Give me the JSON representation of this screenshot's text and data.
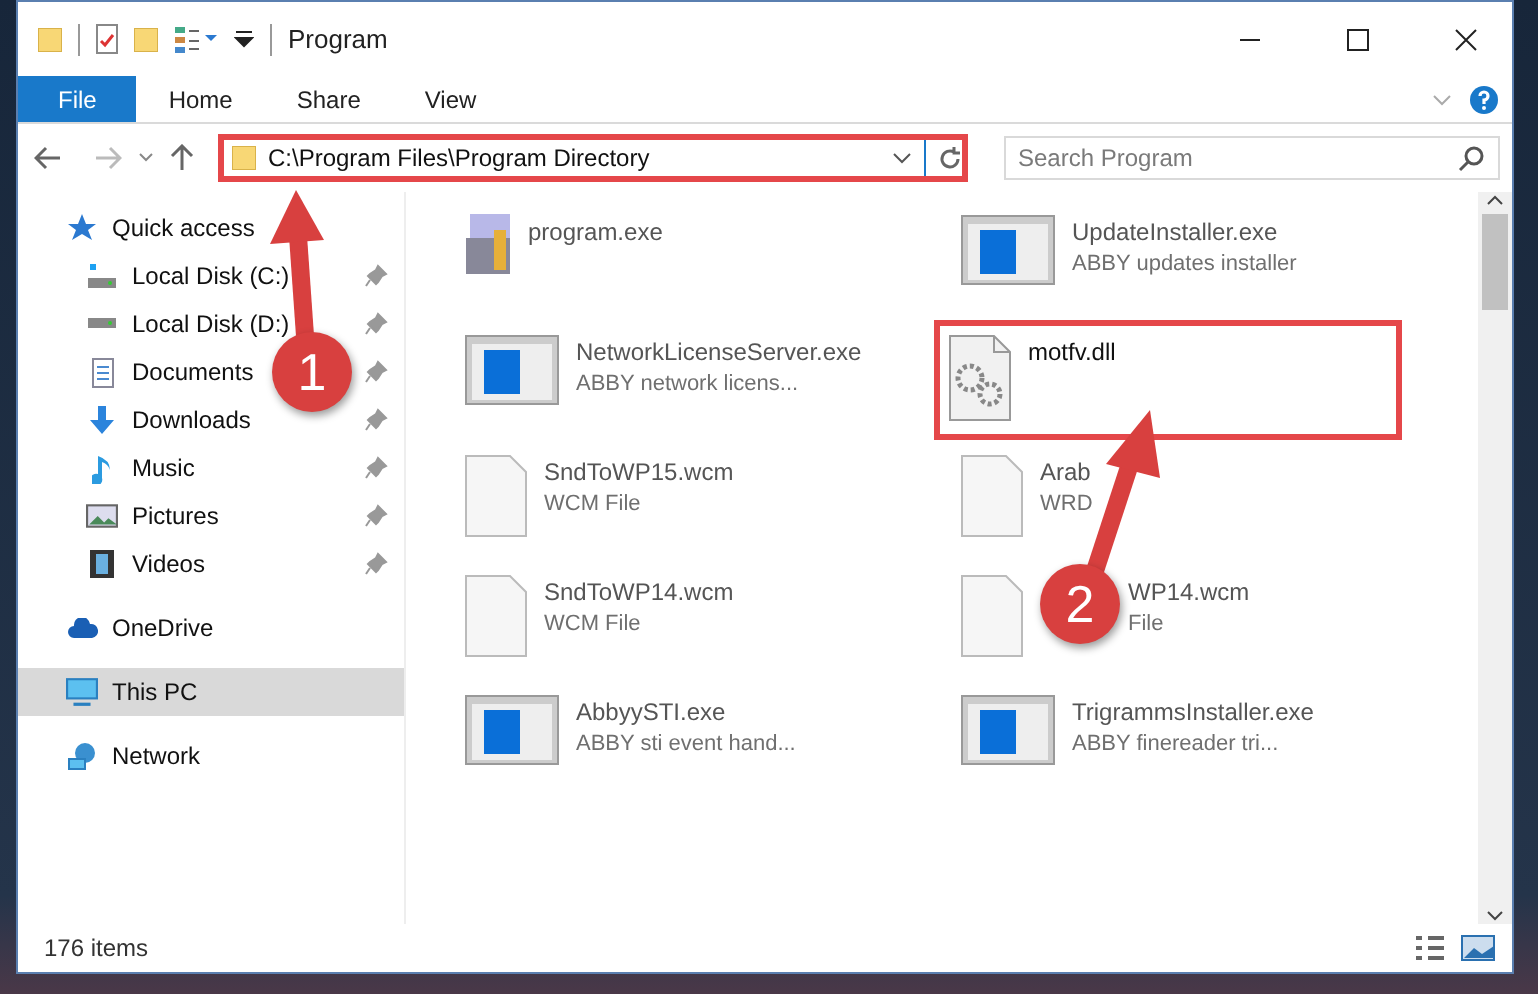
{
  "window": {
    "title": "Program"
  },
  "ribbon_tabs": [
    {
      "label": "File",
      "selected": true
    },
    {
      "label": "Home",
      "selected": false
    },
    {
      "label": "Share",
      "selected": false
    },
    {
      "label": "View",
      "selected": false
    }
  ],
  "address": {
    "path": "C:\\Program Files\\Program Directory",
    "highlighted": true
  },
  "search": {
    "placeholder": "Search Program"
  },
  "sidebar": {
    "items": [
      {
        "label": "Quick access",
        "selected": false,
        "children": [
          {
            "label": "Local Disk (C:)",
            "pinned": true,
            "selected": false
          },
          {
            "label": "Local Disk (D:)",
            "pinned": true,
            "selected": false
          },
          {
            "label": "Documents",
            "pinned": true,
            "selected": false
          },
          {
            "label": "Downloads",
            "pinned": true,
            "selected": false
          },
          {
            "label": "Music",
            "pinned": true,
            "selected": false
          },
          {
            "label": "Pictures",
            "pinned": true,
            "selected": false
          },
          {
            "label": "Videos",
            "pinned": true,
            "selected": false
          }
        ]
      },
      {
        "label": "OneDrive",
        "selected": false
      },
      {
        "label": "This PC",
        "selected": true
      },
      {
        "label": "Network",
        "selected": false
      }
    ]
  },
  "files": [
    {
      "name": "program.exe",
      "kind": "installer",
      "highlighted": false
    },
    {
      "name": "UpdateInstaller.exe",
      "description": "ABBY updates installer",
      "kind": "application",
      "highlighted": false
    },
    {
      "name": "NetworkLicenseServer.exe",
      "description": "ABBY network licens...",
      "kind": "application",
      "highlighted": false
    },
    {
      "name": "motfv.dll",
      "kind": "dll",
      "highlighted": true
    },
    {
      "name": "SndToWP15.wcm",
      "description": "WCM File",
      "kind": "document",
      "highlighted": false
    },
    {
      "name": "Arab",
      "description": "WRD",
      "kind": "document",
      "highlighted": false
    },
    {
      "name": "SndToWP14.wcm",
      "description": "WCM File",
      "kind": "document",
      "highlighted": false
    },
    {
      "name": "WP14.wcm",
      "description": "File",
      "kind": "document",
      "highlighted": false
    },
    {
      "name": "AbbyySTI.exe",
      "description": "ABBY sti event hand...",
      "kind": "application",
      "highlighted": false
    },
    {
      "name": "TrigrammsInstaller.exe",
      "description": "ABBY finereader tri...",
      "kind": "application",
      "highlighted": false
    }
  ],
  "status_bar": {
    "count": "176 items"
  },
  "callouts": [
    {
      "number": "1"
    },
    {
      "number": "2"
    }
  ]
}
